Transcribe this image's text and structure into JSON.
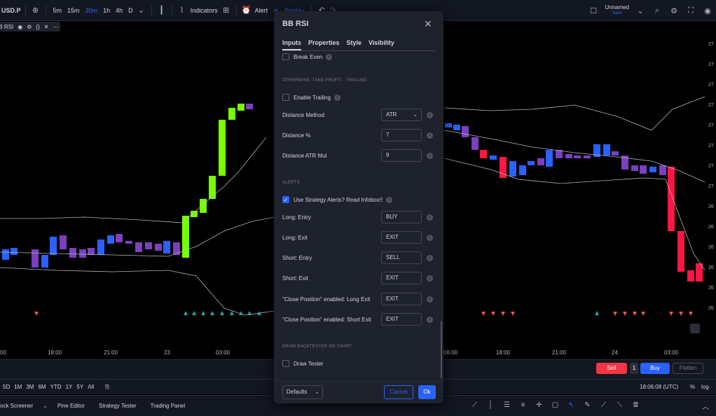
{
  "topbar": {
    "symbol": "USD.P",
    "intervals": [
      "5m",
      "15m",
      "30m",
      "1h",
      "4h",
      "D"
    ],
    "active_interval": "30m",
    "indicators": "Indicators",
    "alert": "Alert",
    "replay": "Replay",
    "layout_name": "Unnamed",
    "layout_status": "Save"
  },
  "legend": {
    "name": "BB RSI"
  },
  "chart": {
    "time_labels": [
      "00",
      "18:00",
      "21:00",
      "23",
      "03:00",
      "06:00",
      "18:00",
      "21:00",
      "24",
      "03:00"
    ],
    "price_labels": [
      "27",
      "27",
      "27",
      "27",
      "27",
      "27",
      "27",
      "27",
      "26",
      "26",
      "26",
      "26",
      "26",
      "26"
    ],
    "accent": "#2962ff"
  },
  "trade": {
    "sell": "Sell",
    "qty": "1",
    "buy": "Buy",
    "flatten": "Flatten"
  },
  "ranges": [
    "5D",
    "1M",
    "3M",
    "6M",
    "YTD",
    "1Y",
    "5Y",
    "All"
  ],
  "clock": "18:06:08 (UTC)",
  "scale": {
    "pct": "%",
    "log": "log"
  },
  "bottom_tabs": [
    "ock Screener",
    "Pine Editor",
    "Strategy Tester",
    "Trading Panel"
  ],
  "dialog": {
    "title": "BB RSI",
    "tabs": [
      "Inputs",
      "Properties",
      "Style",
      "Visibility"
    ],
    "active_tab": "Inputs",
    "break_even": "Break Even",
    "section_trailing": "OTHERWISE: TAKE PROFIT - TRAILING",
    "enable_trailing": "Enable Trailing",
    "distance_method": {
      "label": "Distance Method",
      "value": "ATR"
    },
    "distance_pct": {
      "label": "Distance %",
      "value": "7"
    },
    "distance_atr": {
      "label": "Distance ATR Mul",
      "value": "9"
    },
    "section_alerts": "ALERTS",
    "use_alerts": "Use Strategy Alerts? Read Infobox!!",
    "alerts": [
      {
        "label": "Long: Entry",
        "value": "BUY"
      },
      {
        "label": "Long: Exit",
        "value": "EXIT"
      },
      {
        "label": "Short: Entry",
        "value": "SELL"
      },
      {
        "label": "Short: Exit",
        "value": "EXIT"
      },
      {
        "label": "\"Close Position\" enabled: Long Exit",
        "value": "EXIT"
      },
      {
        "label": "\"Close Position\" enabled: Short Exit",
        "value": "EXIT"
      }
    ],
    "section_backtester": "DRAW BACKTESTER ON CHART",
    "draw_tester": "Draw Tester",
    "defaults": "Defaults",
    "cancel": "Cancel",
    "ok": "Ok"
  }
}
